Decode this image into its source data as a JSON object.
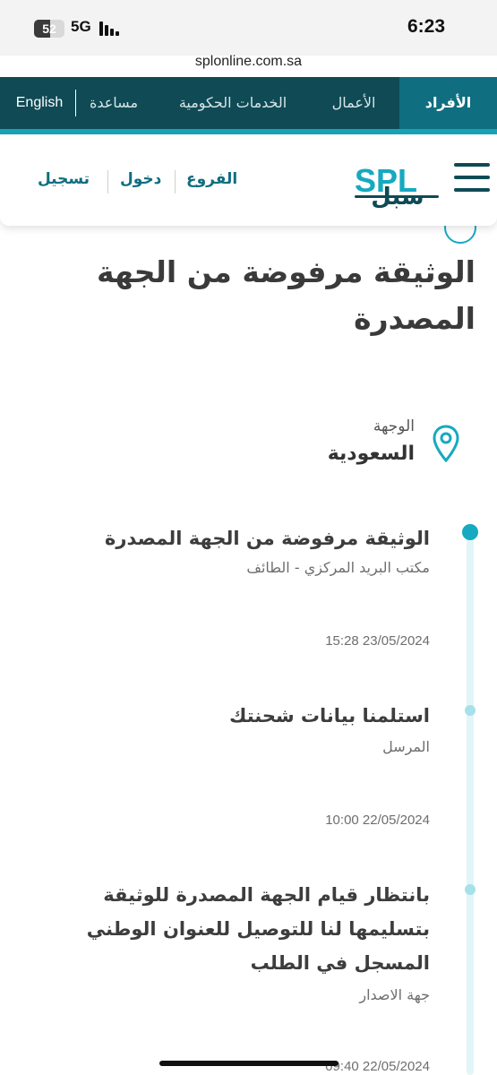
{
  "status_bar": {
    "battery": "52",
    "battery_level_percent": 52,
    "network": "5G",
    "time": "6:23",
    "url": "splonline.com.sa"
  },
  "top_nav": {
    "individuals": "الأفراد",
    "business": "الأعمال",
    "gov_services": "الخدمات الحكومية",
    "help": "مساعدة",
    "language": "English"
  },
  "header": {
    "logo_text": "SPL",
    "logo_arabic": "سبل",
    "branches": "الفروع",
    "login": "دخول",
    "register": "تسجيل"
  },
  "shipment": {
    "status_title": "الوثيقة مرفوضة من الجهة المصدرة",
    "destination_label": "الوجهة",
    "destination_value": "السعودية"
  },
  "timeline": [
    {
      "title": "الوثيقة مرفوضة من الجهة المصدرة",
      "location": "مكتب البريد المركزي - الطائف",
      "time": "15:28 23/05/2024"
    },
    {
      "title": "استلمنا بيانات شحنتك",
      "location": "المرسل",
      "time": "10:00 22/05/2024"
    },
    {
      "title": "بانتظار قيام الجهة المصدرة للوثيقة بتسليمها لنا للتوصيل للعنوان الوطني المسجل في الطلب",
      "location": "جهة الاصدار",
      "time": "09:40 22/05/2024"
    }
  ],
  "colors": {
    "nav_dark": "#0f4a55",
    "nav_active": "#0f6e80",
    "accent": "#16a9c0"
  }
}
